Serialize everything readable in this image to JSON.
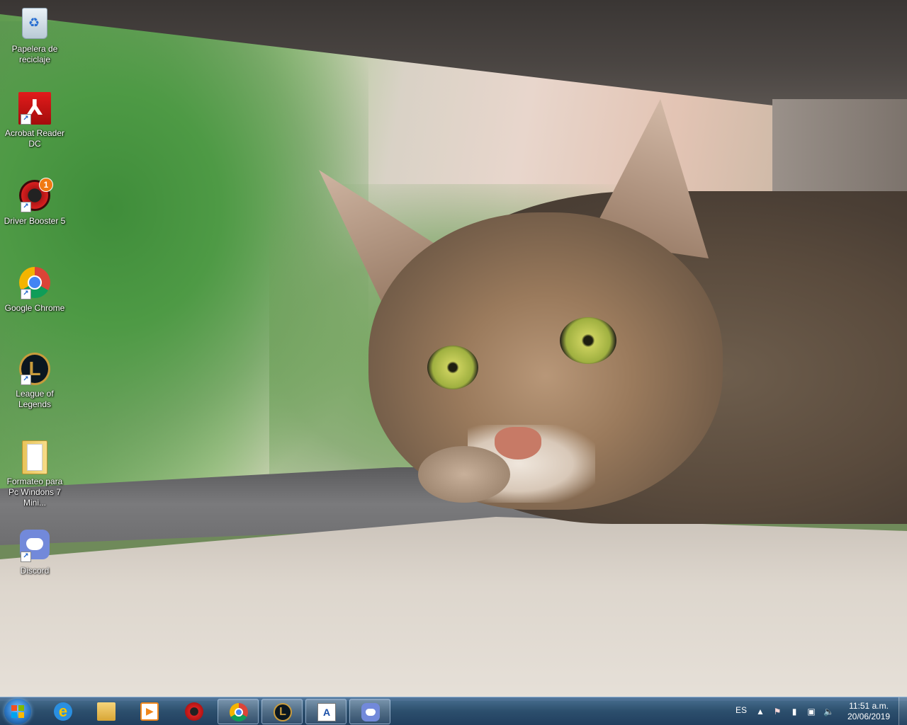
{
  "desktop_icons": [
    {
      "label": "Papelera de reciclaje",
      "icon": "recycle-bin-icon",
      "shortcut": false
    },
    {
      "label": "Acrobat Reader DC",
      "icon": "acrobat-reader-icon",
      "shortcut": true
    },
    {
      "label": "Driver Booster 5",
      "icon": "driver-booster-icon",
      "shortcut": true,
      "badge": "1"
    },
    {
      "label": "Google Chrome",
      "icon": "chrome-icon",
      "shortcut": true
    },
    {
      "label": "League of Legends",
      "icon": "league-of-legends-icon",
      "shortcut": true
    },
    {
      "label": "Formateo para Pc Windons 7 Mini...",
      "icon": "folder-icon",
      "shortcut": false
    },
    {
      "label": "Discord",
      "icon": "discord-icon",
      "shortcut": true
    }
  ],
  "taskbar": {
    "pinned": [
      {
        "name": "Internet Explorer",
        "icon": "internet-explorer-icon",
        "open": false,
        "glyph": "e"
      },
      {
        "name": "Windows Explorer",
        "icon": "file-explorer-icon",
        "open": false
      },
      {
        "name": "Windows Media Player",
        "icon": "media-player-icon",
        "open": false
      },
      {
        "name": "Driver Booster",
        "icon": "driver-booster-icon",
        "open": false
      },
      {
        "name": "Google Chrome",
        "icon": "chrome-icon",
        "open": true
      },
      {
        "name": "League of Legends",
        "icon": "league-of-legends-icon",
        "open": true,
        "glyph": "L"
      },
      {
        "name": "WordPad",
        "icon": "wordpad-icon",
        "open": true,
        "glyph": "A"
      },
      {
        "name": "Discord",
        "icon": "discord-icon",
        "open": true
      }
    ],
    "tray": {
      "language": "ES",
      "icons": [
        "show-hidden-icons-icon",
        "action-center-flag-icon",
        "power-icon",
        "network-icon",
        "volume-icon"
      ],
      "time": "11:51 a.m.",
      "date": "20/06/2019"
    }
  },
  "colors": {
    "taskbar": "#2e5a85",
    "discord": "#7289da",
    "acrobat": "#e21b1b"
  }
}
